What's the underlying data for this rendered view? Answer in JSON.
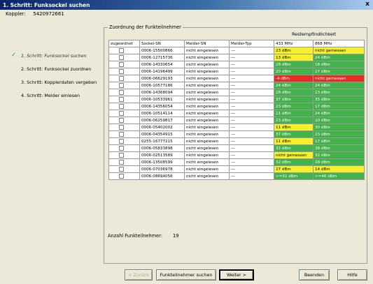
{
  "window": {
    "title": "1. Schritt: Funksockel suchen",
    "close_label": "x"
  },
  "coupler": {
    "label": "Koppler:",
    "value": "5420972661"
  },
  "steps": [
    {
      "label": "1. Schritt: Funksockel suchen",
      "active": true
    },
    {
      "label": "2. Schritt: Funksockel zuordnen",
      "active": false
    },
    {
      "label": "3. Schritt: Kopplerdaten vergeben",
      "active": false
    },
    {
      "label": "4. Schritt: Melder einlesen",
      "active": false
    }
  ],
  "group": {
    "title": "Zuordnung der Funkteilnehmer",
    "reste_title": "Restempfindlichkeit",
    "columns": [
      "zugeordnet",
      "Sockel-SN",
      "Melder-SN",
      "Melder-Typ",
      "433 MHz",
      "868 MHz"
    ],
    "rows": [
      {
        "sockel": "0006-15500866",
        "melder": "nicht eingelesen",
        "typ": "---",
        "f433": "23 dBm",
        "c433": "yellow",
        "f868": "nicht gemessen",
        "c868": "yellow"
      },
      {
        "sockel": "0006-12715736",
        "melder": "nicht eingelesen",
        "typ": "---",
        "f433": "13 dBm",
        "c433": "yellow",
        "f868": "24 dBm",
        "c868": "green"
      },
      {
        "sockel": "0006-14330654",
        "melder": "nicht eingelesen",
        "typ": "---",
        "f433": "28 dBm",
        "c433": "green",
        "f868": "18 dBm",
        "c868": "green"
      },
      {
        "sockel": "0006-14196499",
        "melder": "nicht eingelesen",
        "typ": "---",
        "f433": "20 dBm",
        "c433": "green",
        "f868": "27 dBm",
        "c868": "green"
      },
      {
        "sockel": "0006-06629193",
        "melder": "nicht eingelesen",
        "typ": "---",
        "f433": "-4 dBm",
        "c433": "red",
        "f868": "nicht gemessen",
        "c868": "red"
      },
      {
        "sockel": "0006-10577186",
        "melder": "nicht eingelesen",
        "typ": "---",
        "f433": "24 dBm",
        "c433": "green",
        "f868": "24 dBm",
        "c868": "green"
      },
      {
        "sockel": "0006-14368094",
        "melder": "nicht eingelesen",
        "typ": "---",
        "f433": "28 dBm",
        "c433": "green",
        "f868": "23 dBm",
        "c868": "green"
      },
      {
        "sockel": "0006-10533961",
        "melder": "nicht eingelesen",
        "typ": "---",
        "f433": "37 dBm",
        "c433": "green",
        "f868": "35 dBm",
        "c868": "green"
      },
      {
        "sockel": "0006-14356054",
        "melder": "nicht eingelesen",
        "typ": "---",
        "f433": "23 dBm",
        "c433": "green",
        "f868": "17 dBm",
        "c868": "green"
      },
      {
        "sockel": "0006-10514114",
        "melder": "nicht eingelesen",
        "typ": "---",
        "f433": "21 dBm",
        "c433": "green",
        "f868": "24 dBm",
        "c868": "green"
      },
      {
        "sockel": "0006-06259817",
        "melder": "nicht eingelesen",
        "typ": "---",
        "f433": "23 dBm",
        "c433": "green",
        "f868": "20 dBm",
        "c868": "green"
      },
      {
        "sockel": "0006-05402002",
        "melder": "nicht eingelesen",
        "typ": "---",
        "f433": "11 dBm",
        "c433": "yellow",
        "f868": "30 dBm",
        "c868": "green"
      },
      {
        "sockel": "0006-04354915",
        "melder": "nicht eingelesen",
        "typ": "---",
        "f433": "37 dBm",
        "c433": "green",
        "f868": "23 dBm",
        "c868": "green"
      },
      {
        "sockel": "0255-16777215",
        "melder": "nicht eingelesen",
        "typ": "---",
        "f433": "11 dBm",
        "c433": "yellow",
        "f868": "17 dBm",
        "c868": "green"
      },
      {
        "sockel": "0006-05833898",
        "melder": "nicht eingelesen",
        "typ": "---",
        "f433": "32 dBm",
        "c433": "green",
        "f868": "38 dBm",
        "c868": "green"
      },
      {
        "sockel": "0006-02513589",
        "melder": "nicht eingelesen",
        "typ": "---",
        "f433": "nicht gemessen",
        "c433": "yellow",
        "f868": "32 dBm",
        "c868": "green"
      },
      {
        "sockel": "0006-13508599",
        "melder": "nicht eingelesen",
        "typ": "---",
        "f433": "32 dBm",
        "c433": "green",
        "f868": "28 dBm",
        "c868": "green"
      },
      {
        "sockel": "0006-07036978",
        "melder": "nicht eingelesen",
        "typ": "---",
        "f433": "27 dBm",
        "c433": "yellow",
        "f868": "14 dBm",
        "c868": "yellow"
      },
      {
        "sockel": "0006-08694056",
        "melder": "nicht eingelesen",
        "typ": "---",
        "f433": ">=51 dBm",
        "c433": "green",
        "f868": ">=46 dBm",
        "c868": "green"
      }
    ],
    "count_label": "Anzahl Funkteilnehmer:",
    "count_value": "19"
  },
  "buttons": {
    "back": "< Zurück",
    "search": "Funkteilnehmer suchen",
    "next": "Weiter >",
    "quit": "Beenden",
    "help": "Hilfe"
  },
  "colors": {
    "green": "#44b24a",
    "yellow": "#f6f12b",
    "red": "#e42c24"
  }
}
